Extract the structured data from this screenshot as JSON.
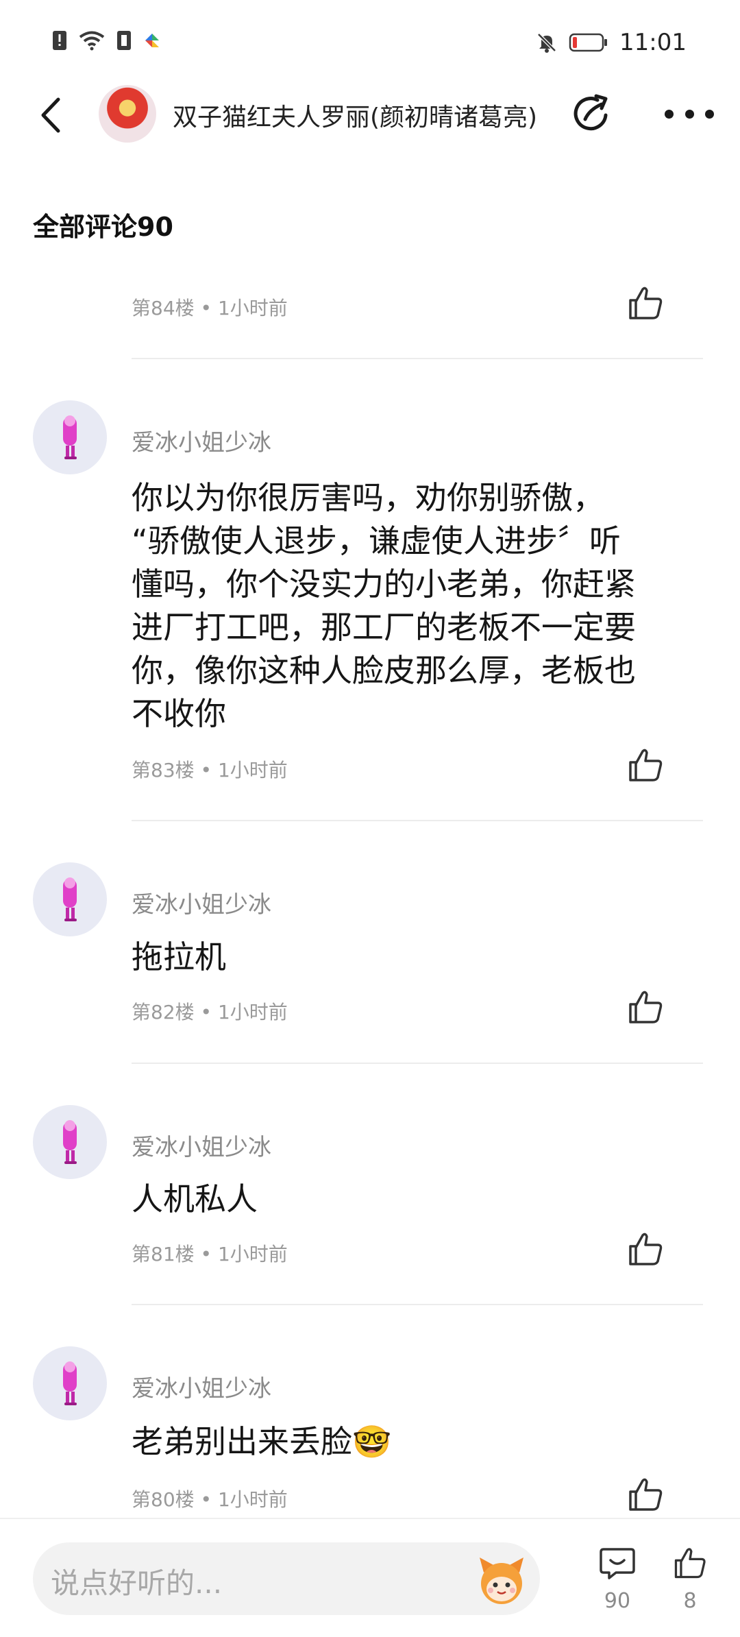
{
  "status_bar": {
    "time": "11:01"
  },
  "header": {
    "author_name": "双子猫红夫人罗丽(颜初晴诸葛亮)"
  },
  "section": {
    "title": "全部评论90"
  },
  "comments": [
    {
      "meta": "第84楼 • 1小时前"
    },
    {
      "username": "爱冰小姐少冰",
      "lines": [
        "你以为你很厉害吗，劝你别骄傲，",
        "“骄傲使人退步，谦虚使人进步〞听",
        "懂吗，你个没实力的小老弟，你赶紧",
        "进厂打工吧，那工厂的老板不一定要",
        "你，像你这种人脸皮那么厚，老板也",
        "不收你"
      ],
      "meta": "第83楼 • 1小时前"
    },
    {
      "username": "爱冰小姐少冰",
      "text": "拖拉机",
      "meta": "第82楼 • 1小时前"
    },
    {
      "username": "爱冰小姐少冰",
      "text": "人机私人",
      "meta": "第81楼 • 1小时前"
    },
    {
      "username": "爱冰小姐少冰",
      "text": "老弟别出来丢脸🤓",
      "meta": "第80楼 • 1小时前"
    }
  ],
  "bottom_bar": {
    "input_placeholder": "说点好听的...",
    "comment_count": "90",
    "like_count": "8"
  },
  "icons": {
    "status": [
      "alert-sim-icon",
      "wifi-icon",
      "sim-icon",
      "app-notify-icon",
      "mute-bell-icon",
      "battery-icon"
    ],
    "header": [
      "back-icon",
      "share-icon",
      "more-icon"
    ],
    "comment": "thumbs-up-icon"
  },
  "colors": {
    "meta_text": "#9a9a9a",
    "username_text": "#8a8a8a",
    "divider": "#ececec",
    "battery_low": "#e53935"
  }
}
